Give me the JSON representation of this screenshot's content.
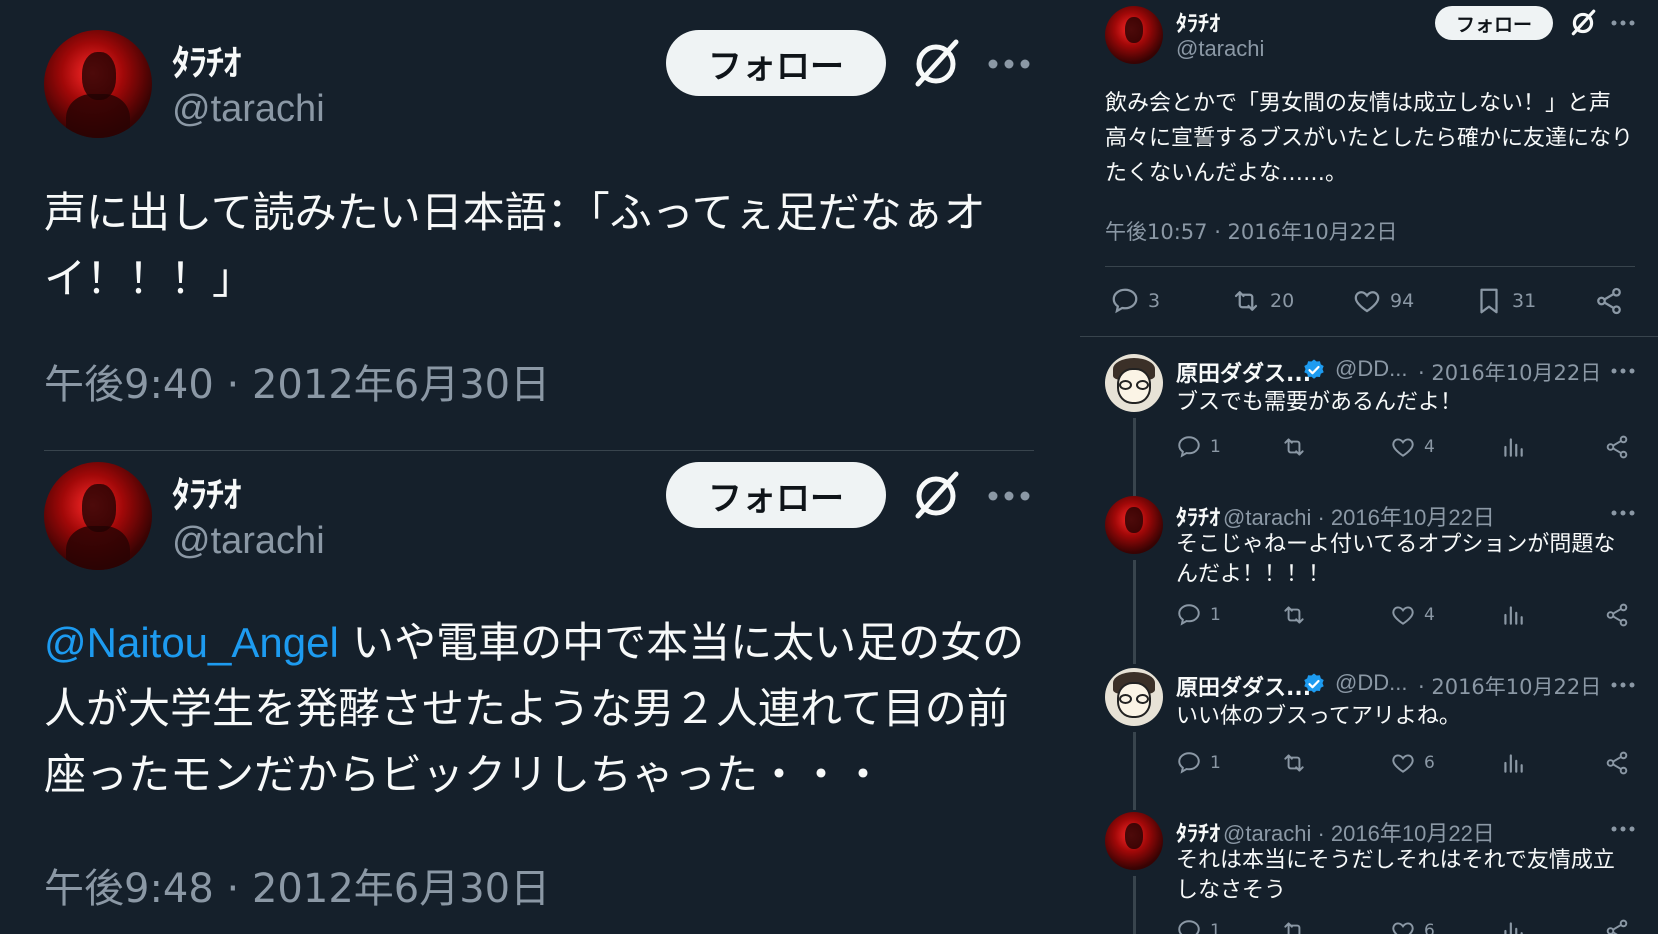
{
  "left": {
    "tweets": [
      {
        "name": "ﾀﾗﾁｵ",
        "handle": "@tarachi",
        "follow_label": "フォロー",
        "text": "声に出して読みたい日本語：「ふってぇ足だなぁオイ！！！」",
        "time": "午後9:40 · 2012年6月30日"
      },
      {
        "name": "ﾀﾗﾁｵ",
        "handle": "@tarachi",
        "follow_label": "フォロー",
        "mention": "@Naitou_Angel",
        "text": " いや電車の中で本当に太い足の女の人が大学生を発酵させたような男２人連れて目の前座ったモンだからビックリしちゃった・・・",
        "time": "午後9:48 · 2012年6月30日"
      }
    ]
  },
  "right": {
    "main": {
      "name": "ﾀﾗﾁｵ",
      "handle": "@tarachi",
      "follow_label": "フォロー",
      "text": "飲み会とかで「男女間の友情は成立しない！」と声高々に宣誓するブスがいたとしたら確かに友達になりたくないんだよな……。",
      "time": "午後10:57 · 2016年10月22日",
      "replies": "3",
      "retweets": "20",
      "likes": "94",
      "bookmarks": "31"
    },
    "replies": [
      {
        "avatar": "cartoon",
        "name": "原田ダダス...",
        "handle": "@DD...",
        "date": "· 2016年10月22日",
        "verified": true,
        "text": "ブスでも需要があるんだよ！",
        "reply_count": "1",
        "like_count": "4"
      },
      {
        "avatar": "red",
        "name": "ﾀﾗﾁｵ",
        "handle": "@tarachi · 2016年10月22日",
        "date": "",
        "verified": false,
        "text": "そこじゃねーよ付いてるオプションが問題なんだよ！！！！",
        "reply_count": "1",
        "like_count": "4"
      },
      {
        "avatar": "cartoon",
        "name": "原田ダダス...",
        "handle": "@DD...",
        "date": "· 2016年10月22日",
        "verified": true,
        "text": "いい体のブスってアリよね。",
        "reply_count": "1",
        "like_count": "6"
      },
      {
        "avatar": "red",
        "name": "ﾀﾗﾁｵ",
        "handle": "@tarachi · 2016年10月22日",
        "date": "",
        "verified": false,
        "text": "それは本当にそうだしそれはそれで友情成立しなさそう",
        "reply_count": "1",
        "like_count": "6"
      }
    ]
  },
  "icons": [
    "grok-icon",
    "more-icon",
    "reply-icon",
    "retweet-icon",
    "like-icon",
    "bookmark-icon",
    "share-icon",
    "views-icon",
    "verified-badge-icon"
  ],
  "colors": {
    "background": "#15202b",
    "link": "#1d9bf0",
    "muted": "#8b98a5",
    "verified": "#1d9bf0"
  }
}
